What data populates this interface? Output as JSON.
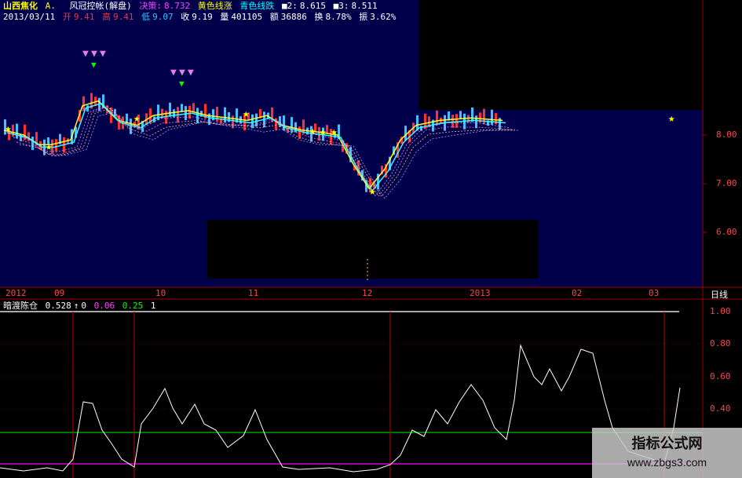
{
  "header": {
    "stock_name": "山西焦化",
    "market": "A.",
    "indicator_name": "风冠控帐(解盘)",
    "decision_label": "决策:",
    "decision_value": "8.732",
    "yellow_line": "黄色线涨",
    "cyan_line": "青色线跌",
    "m2_label": "■2:",
    "m2_value": "8.615",
    "m3_label": "■3:",
    "m3_value": "8.511",
    "date": "2013/03/11",
    "open_label": "开",
    "open_value": "9.41",
    "high_label": "高",
    "high_value": "9.41",
    "low_label": "低",
    "low_value": "9.07",
    "close_label": "收",
    "close_value": "9.19",
    "volume_label": "量",
    "volume_value": "401105",
    "amount_label": "额",
    "amount_value": "36886",
    "turnover_label": "换",
    "turnover_value": "8.78%",
    "amplitude_label": "振",
    "amplitude_value": "3.62%"
  },
  "price_axis": [
    "8.00",
    "7.00",
    "6.00"
  ],
  "time_axis": [
    "2012",
    "09",
    "10",
    "11",
    "12",
    "2013",
    "02",
    "03"
  ],
  "period_label": "日线",
  "indicator": {
    "name": "暗渡陈仓",
    "value": "0.528",
    "v2": "0",
    "v3": "0.06",
    "v4": "0.25",
    "v5": "1"
  },
  "indicator_axis": [
    "1.00",
    "0.80",
    "0.60",
    "0.40"
  ],
  "watermark": {
    "title": "指标公式网",
    "url": "www.zbgs3.com"
  },
  "colors": {
    "up_candle": "#ff3030",
    "down_candle": "#40c0ff",
    "ma_yellow": "#ffff30",
    "ma_cyan": "#30ffff",
    "bg_main": "#000050",
    "grid_red": "#a00000",
    "indicator_line": "#ffffff",
    "green_line": "#00ff00",
    "magenta_line": "#ff00ff"
  }
}
